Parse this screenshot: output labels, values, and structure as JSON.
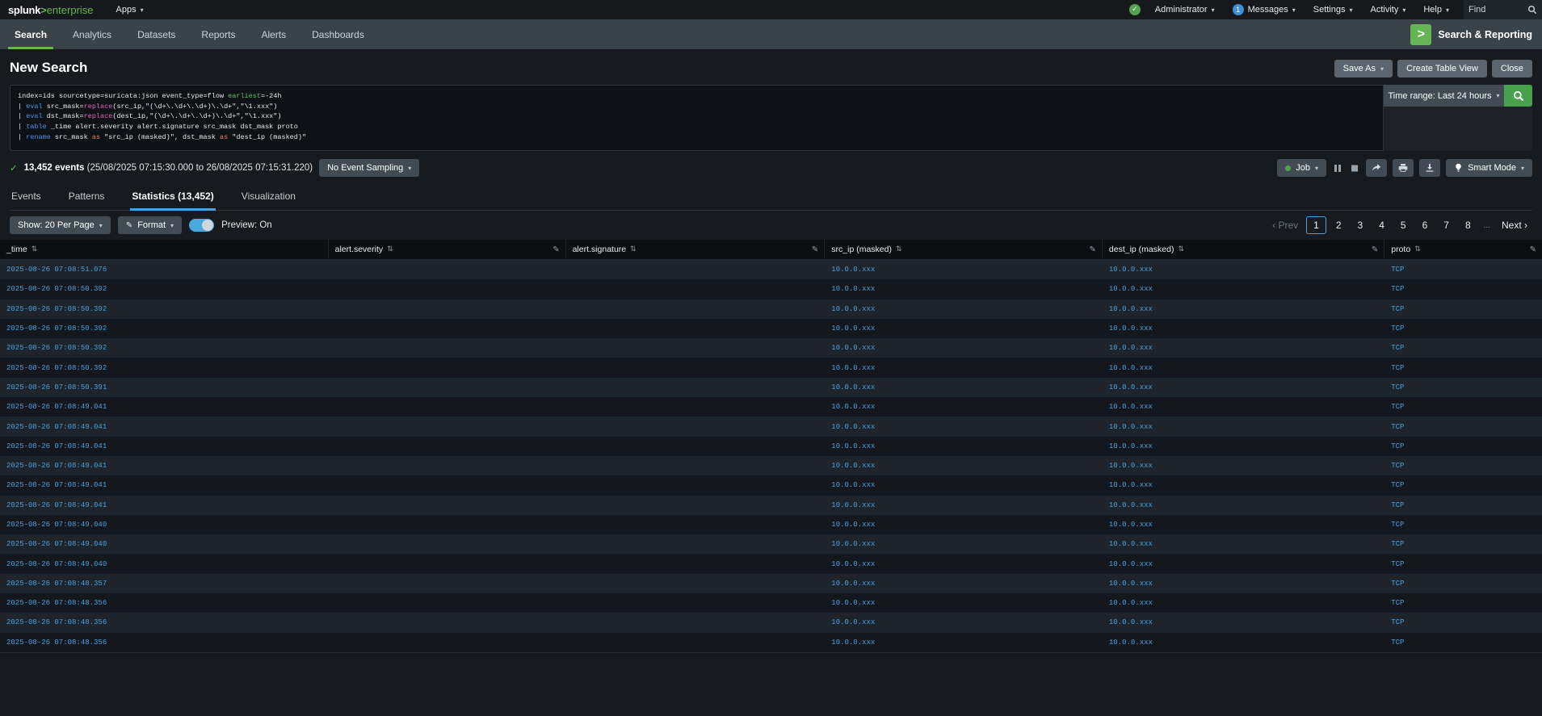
{
  "colors": {
    "brand_green": "#65b554",
    "accent_blue": "#4a9fd4",
    "link_blue": "#4f9fd9",
    "success_green": "#53a051",
    "toggle_blue": "#4aa8e0"
  },
  "topbar": {
    "logo_splunk": "splunk",
    "logo_gt": ">",
    "logo_suffix": "enterprise",
    "apps_label": "Apps",
    "administrator_label": "Administrator",
    "messages_label": "Messages",
    "messages_count": "1",
    "settings_label": "Settings",
    "activity_label": "Activity",
    "help_label": "Help",
    "find_placeholder": "Find"
  },
  "appbar": {
    "items": [
      {
        "label": "Search"
      },
      {
        "label": "Analytics"
      },
      {
        "label": "Datasets"
      },
      {
        "label": "Reports"
      },
      {
        "label": "Alerts"
      },
      {
        "label": "Dashboards"
      }
    ],
    "app_icon_glyph": ">",
    "app_name": "Search & Reporting"
  },
  "header": {
    "title": "New Search",
    "save_as_label": "Save As",
    "create_table_view_label": "Create Table View",
    "close_label": "Close"
  },
  "search": {
    "time_range_label": "Time range: Last 24 hours",
    "query_lines": [
      {
        "tokens": [
          {
            "t": "index=ids sourcetype=suricata:json event_type=flow ",
            "c": "plain"
          },
          {
            "t": "earliest",
            "c": "green"
          },
          {
            "t": "=-24h",
            "c": "plain"
          }
        ]
      },
      {
        "tokens": [
          {
            "t": "| ",
            "c": "plain"
          },
          {
            "t": "eval",
            "c": "blue"
          },
          {
            "t": " src_mask=",
            "c": "plain"
          },
          {
            "t": "replace",
            "c": "pink"
          },
          {
            "t": "(src_ip,\"(\\d+\\.\\d+\\.\\d+)\\.\\d+\",\"\\1.xxx\")",
            "c": "plain"
          }
        ]
      },
      {
        "tokens": [
          {
            "t": "| ",
            "c": "plain"
          },
          {
            "t": "eval",
            "c": "blue"
          },
          {
            "t": " dst_mask=",
            "c": "plain"
          },
          {
            "t": "replace",
            "c": "pink"
          },
          {
            "t": "(dest_ip,\"(\\d+\\.\\d+\\.\\d+)\\.\\d+\",\"\\1.xxx\")",
            "c": "plain"
          }
        ]
      },
      {
        "tokens": [
          {
            "t": "| ",
            "c": "plain"
          },
          {
            "t": "table",
            "c": "blue"
          },
          {
            "t": " _time alert.severity alert.signature src_mask dst_mask proto",
            "c": "plain"
          }
        ]
      },
      {
        "tokens": [
          {
            "t": "| ",
            "c": "plain"
          },
          {
            "t": "rename",
            "c": "blue"
          },
          {
            "t": " src_mask ",
            "c": "plain"
          },
          {
            "t": "as",
            "c": "orange"
          },
          {
            "t": " \"src_ip (masked)\", dst_mask ",
            "c": "plain"
          },
          {
            "t": "as",
            "c": "orange"
          },
          {
            "t": " \"dest_ip (masked)\"",
            "c": "plain"
          }
        ]
      }
    ]
  },
  "results": {
    "check_glyph": "✓",
    "count_bold": "13,452 events",
    "range_text": "(25/08/2025 07:15:30.000 to 26/08/2025 07:15:31.220)",
    "sampling_label": "No Event Sampling",
    "job_label": "Job",
    "smart_mode_label": "Smart Mode"
  },
  "tabs": {
    "items": [
      {
        "label": "Events"
      },
      {
        "label": "Patterns"
      },
      {
        "label": "Statistics (13,452)"
      },
      {
        "label": "Visualization"
      }
    ]
  },
  "controls": {
    "show_label": "Show: 20 Per Page",
    "format_label": "Format",
    "preview_label": "Preview: On",
    "pagination": {
      "prev": "‹ Prev",
      "pages": [
        "1",
        "2",
        "3",
        "4",
        "5",
        "6",
        "7",
        "8"
      ],
      "ellipsis": "...",
      "next": "Next ›",
      "active_page": "1"
    }
  },
  "table": {
    "columns": [
      {
        "label": "_time"
      },
      {
        "label": "alert.severity"
      },
      {
        "label": "alert.signature"
      },
      {
        "label": "src_ip (masked)"
      },
      {
        "label": "dest_ip (masked)"
      },
      {
        "label": "proto"
      }
    ],
    "rows": [
      {
        "time": "2025-08-26 07:08:51.076",
        "severity": "",
        "signature": "",
        "src": "10.0.0.xxx",
        "dest": "10.0.0.xxx",
        "proto": "TCP"
      },
      {
        "time": "2025-08-26 07:08:50.392",
        "severity": "",
        "signature": "",
        "src": "10.0.0.xxx",
        "dest": "10.0.0.xxx",
        "proto": "TCP"
      },
      {
        "time": "2025-08-26 07:08:50.392",
        "severity": "",
        "signature": "",
        "src": "10.0.0.xxx",
        "dest": "10.0.0.xxx",
        "proto": "TCP"
      },
      {
        "time": "2025-08-26 07:08:50.392",
        "severity": "",
        "signature": "",
        "src": "10.0.0.xxx",
        "dest": "10.0.0.xxx",
        "proto": "TCP"
      },
      {
        "time": "2025-08-26 07:08:50.392",
        "severity": "",
        "signature": "",
        "src": "10.0.0.xxx",
        "dest": "10.0.0.xxx",
        "proto": "TCP"
      },
      {
        "time": "2025-08-26 07:08:50.392",
        "severity": "",
        "signature": "",
        "src": "10.0.0.xxx",
        "dest": "10.0.0.xxx",
        "proto": "TCP"
      },
      {
        "time": "2025-08-26 07:08:50.391",
        "severity": "",
        "signature": "",
        "src": "10.0.0.xxx",
        "dest": "10.0.0.xxx",
        "proto": "TCP"
      },
      {
        "time": "2025-08-26 07:08:49.041",
        "severity": "",
        "signature": "",
        "src": "10.0.0.xxx",
        "dest": "10.0.0.xxx",
        "proto": "TCP"
      },
      {
        "time": "2025-08-26 07:08:49.041",
        "severity": "",
        "signature": "",
        "src": "10.0.0.xxx",
        "dest": "10.0.0.xxx",
        "proto": "TCP"
      },
      {
        "time": "2025-08-26 07:08:49.041",
        "severity": "",
        "signature": "",
        "src": "10.0.0.xxx",
        "dest": "10.0.0.xxx",
        "proto": "TCP"
      },
      {
        "time": "2025-08-26 07:08:49.041",
        "severity": "",
        "signature": "",
        "src": "10.0.0.xxx",
        "dest": "10.0.0.xxx",
        "proto": "TCP"
      },
      {
        "time": "2025-08-26 07:08:49.041",
        "severity": "",
        "signature": "",
        "src": "10.0.0.xxx",
        "dest": "10.0.0.xxx",
        "proto": "TCP"
      },
      {
        "time": "2025-08-26 07:08:49.041",
        "severity": "",
        "signature": "",
        "src": "10.0.0.xxx",
        "dest": "10.0.0.xxx",
        "proto": "TCP"
      },
      {
        "time": "2025-08-26 07:08:49.040",
        "severity": "",
        "signature": "",
        "src": "10.0.0.xxx",
        "dest": "10.0.0.xxx",
        "proto": "TCP"
      },
      {
        "time": "2025-08-26 07:08:49.040",
        "severity": "",
        "signature": "",
        "src": "10.0.0.xxx",
        "dest": "10.0.0.xxx",
        "proto": "TCP"
      },
      {
        "time": "2025-08-26 07:08:49.040",
        "severity": "",
        "signature": "",
        "src": "10.0.0.xxx",
        "dest": "10.0.0.xxx",
        "proto": "TCP"
      },
      {
        "time": "2025-08-26 07:08:48.357",
        "severity": "",
        "signature": "",
        "src": "10.0.0.xxx",
        "dest": "10.0.0.xxx",
        "proto": "TCP"
      },
      {
        "time": "2025-08-26 07:08:48.356",
        "severity": "",
        "signature": "",
        "src": "10.0.0.xxx",
        "dest": "10.0.0.xxx",
        "proto": "TCP"
      },
      {
        "time": "2025-08-26 07:08:48.356",
        "severity": "",
        "signature": "",
        "src": "10.0.0.xxx",
        "dest": "10.0.0.xxx",
        "proto": "TCP"
      },
      {
        "time": "2025-08-26 07:08:48.356",
        "severity": "",
        "signature": "",
        "src": "10.0.0.xxx",
        "dest": "10.0.0.xxx",
        "proto": "TCP"
      }
    ]
  }
}
